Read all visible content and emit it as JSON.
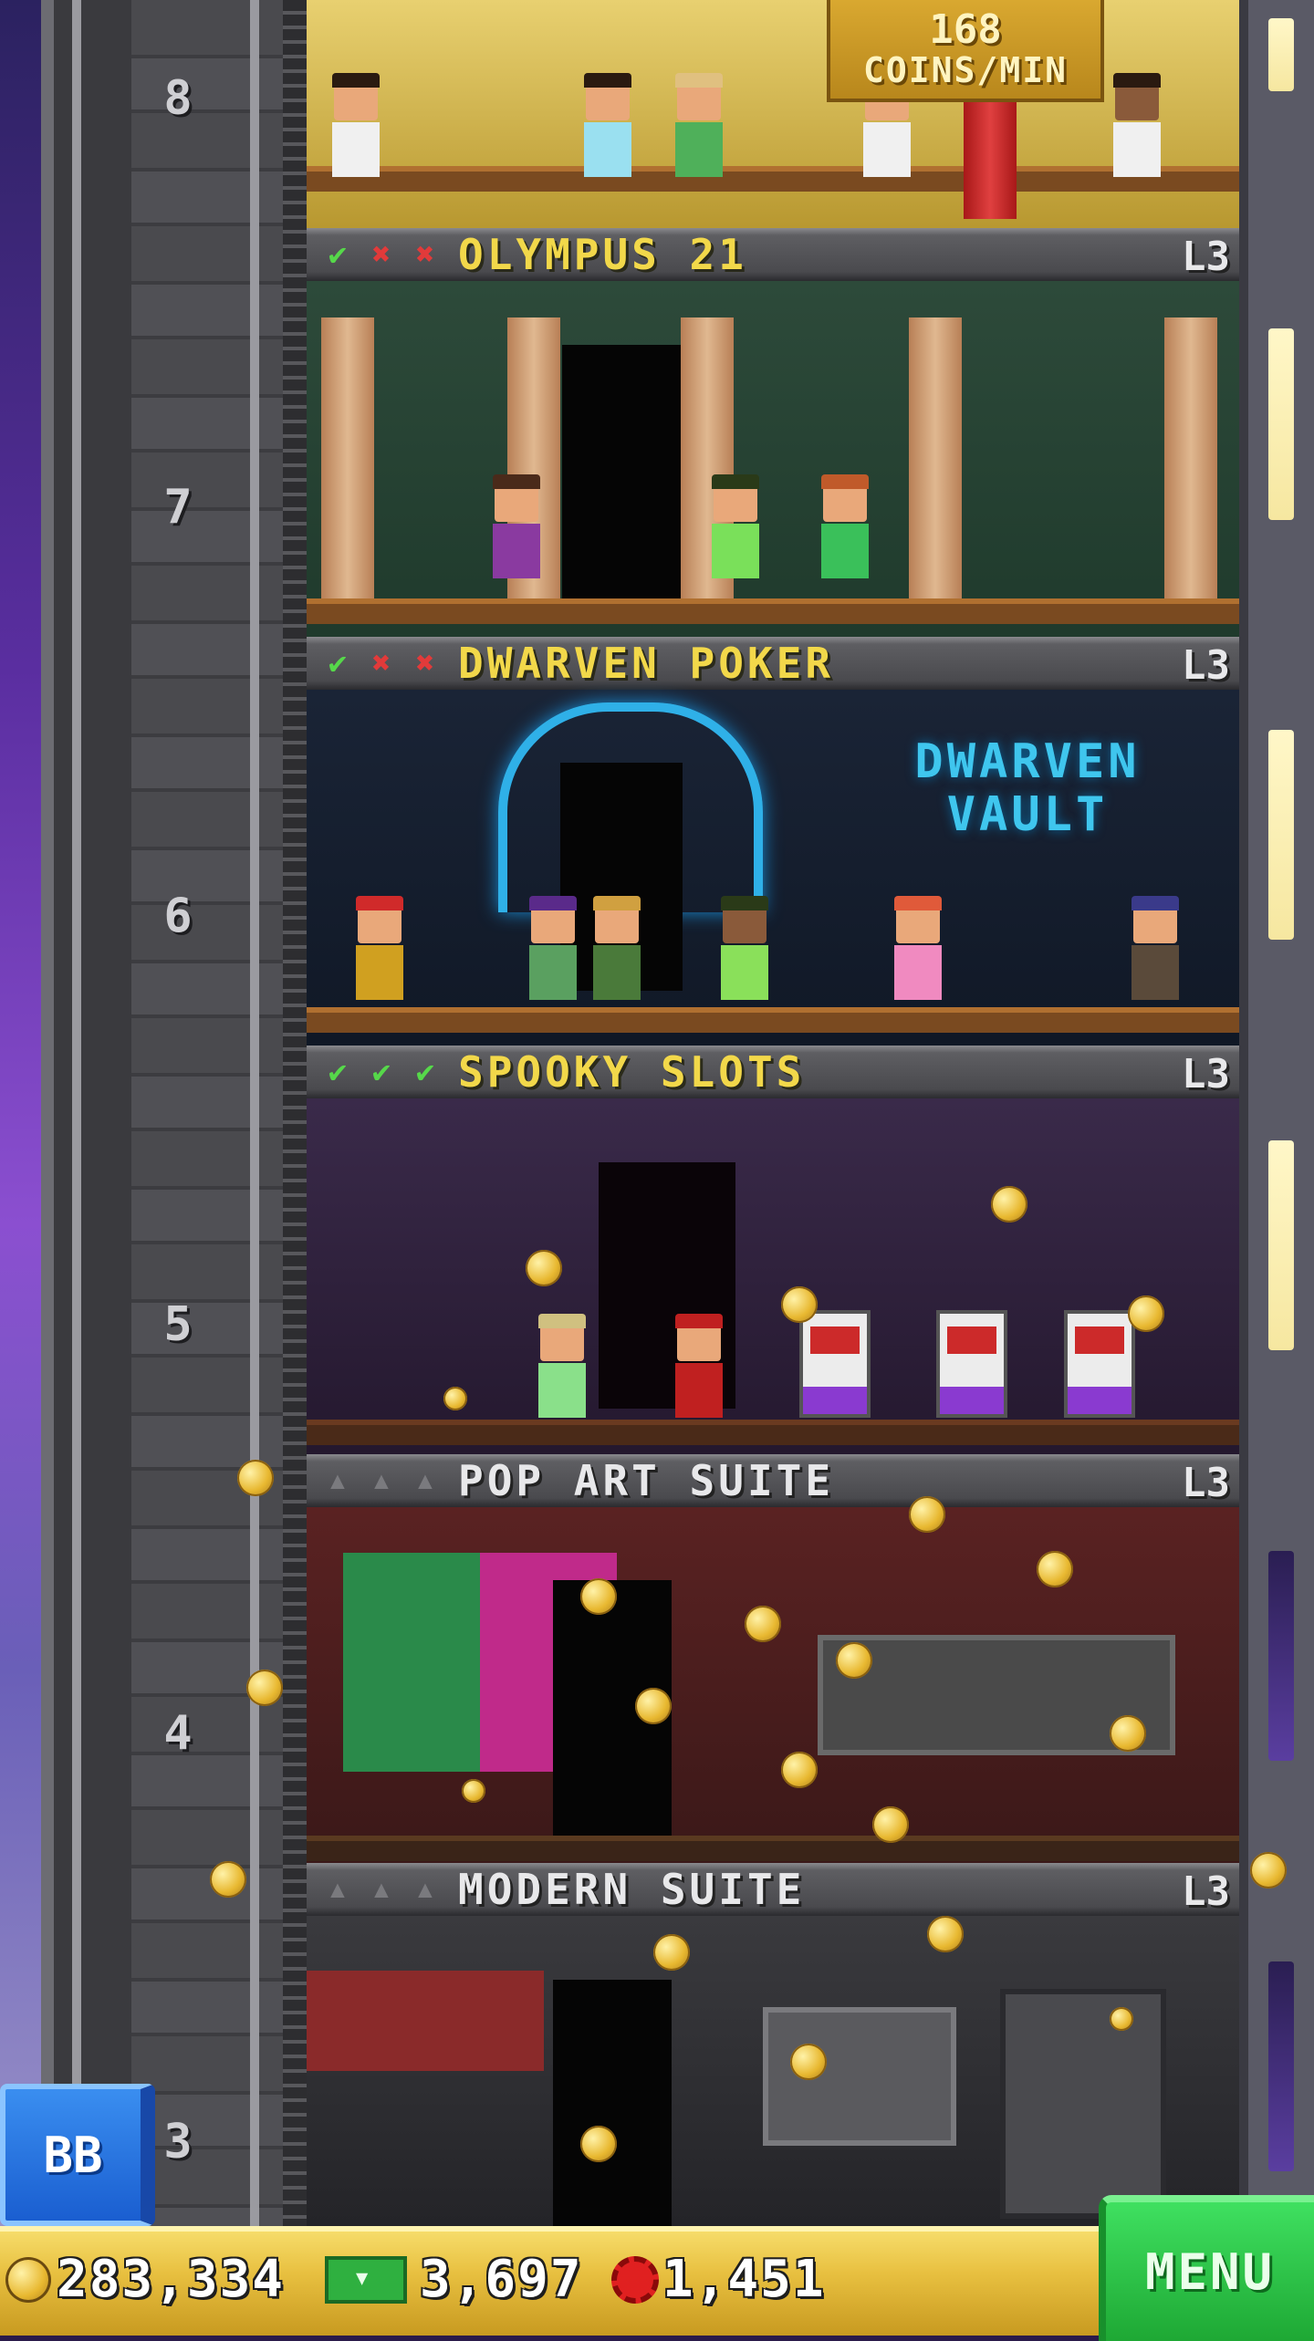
{
  "top_floor": {
    "rate_value": "168",
    "rate_unit": "COINS/MIN"
  },
  "elevator": {
    "floor_numbers": [
      "8",
      "7",
      "6",
      "5",
      "4",
      "3"
    ]
  },
  "rooms": [
    {
      "name": "OLYMPUS 21",
      "level": "L3",
      "stars": [
        "check",
        "x",
        "x"
      ]
    },
    {
      "name": "DWARVEN POKER",
      "level": "L3",
      "stars": [
        "check",
        "x",
        "x"
      ],
      "sign": "DWARVEN VAULT"
    },
    {
      "name": "SPOOKY SLOTS",
      "level": "L3",
      "stars": [
        "check",
        "check",
        "check"
      ]
    },
    {
      "name": "POP ART SUITE",
      "level": "L3",
      "stars": [
        "empty",
        "empty",
        "empty"
      ]
    },
    {
      "name": "MODERN SUITE",
      "level": "L3",
      "stars": [
        "empty",
        "empty",
        "empty"
      ]
    }
  ],
  "sign_lines": [
    "DWARVEN",
    "VAULT"
  ],
  "status_bar": {
    "coins": "283,334",
    "bux": "3,697",
    "chips": "1,451",
    "menu_label": "MENU"
  },
  "bb_button": {
    "label": "BB"
  },
  "colors": {
    "room_name_gold": "#f2d84a",
    "room_name_grey": "#e8e8ea",
    "menu_green": "#1ea834",
    "bb_blue": "#1a5ed0",
    "status_bar_gold": "#e8c040"
  },
  "icons": {
    "check": "check-icon",
    "x": "x-icon",
    "empty": "empty-star-icon",
    "coins": "coin-icon",
    "bux": "bux-icon",
    "chips": "chip-icon"
  }
}
